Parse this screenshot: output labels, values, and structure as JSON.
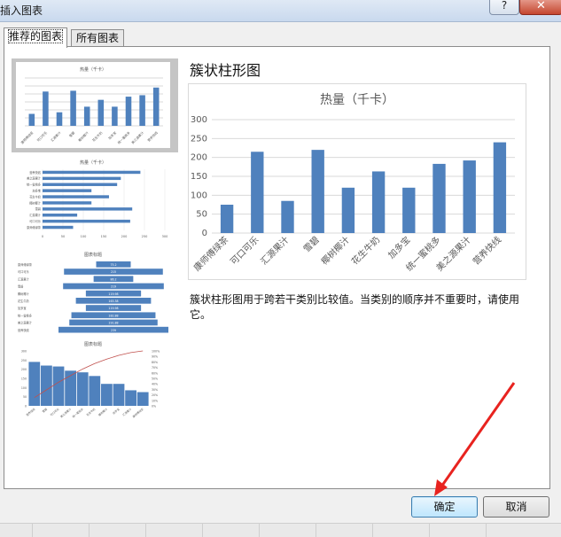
{
  "window": {
    "title": "插入图表",
    "help": "?",
    "close": "✕"
  },
  "tabs": {
    "recommended": "推荐的图表",
    "all": "所有图表"
  },
  "detail": {
    "chart_name": "簇状柱形图",
    "description": "簇状柱形图用于跨若干类别比较值。当类别的顺序并不重要时，请使用它。"
  },
  "buttons": {
    "ok": "确定",
    "cancel": "取消"
  },
  "colors": {
    "accent": "#4f81bd",
    "pareto_line": "#c0504d",
    "selected": "#c5c5c5"
  },
  "chart_data": [
    {
      "type": "bar",
      "title": "热量（千卡）",
      "categories": [
        "康师傅绿茶",
        "可口可乐",
        "汇源果汁",
        "雪碧",
        "椰树椰汁",
        "花生牛奶",
        "加多宝",
        "统一蜜桃多",
        "美之源果汁",
        "营养快线"
      ],
      "values": [
        75,
        215,
        85,
        220,
        120,
        163,
        120,
        183,
        192,
        240
      ],
      "ylim": [
        0,
        300
      ],
      "yticks": [
        0,
        50,
        100,
        150,
        200,
        250,
        300
      ],
      "grid": true
    },
    {
      "type": "bar",
      "orientation": "horizontal",
      "title": "热量（千卡）",
      "categories": [
        "营养快线",
        "美之源果汁",
        "统一蜜桃多",
        "加多宝",
        "花生牛奶",
        "椰树椰汁",
        "雪碧",
        "汇源果汁",
        "可口可乐",
        "康师傅绿茶"
      ],
      "values": [
        240,
        192,
        183,
        120,
        163,
        120,
        220,
        85,
        215,
        75
      ],
      "xlim": [
        0,
        300
      ],
      "xticks": [
        0,
        50,
        100,
        150,
        200,
        250,
        300
      ]
    },
    {
      "type": "bar",
      "orientation": "horizontal",
      "title": "图表标题",
      "categories": [
        "康师傅绿茶",
        "可口可乐",
        "汇源果汁",
        "雪碧",
        "椰树椰汁",
        "花生牛奶",
        "加多宝",
        "统一蜜桃多",
        "美之源果汁",
        "营养快线"
      ],
      "values": [
        75.2,
        215,
        86.2,
        219,
        119.98,
        163.38,
        119.98,
        182.88,
        191.88,
        239
      ]
    },
    {
      "type": "bar",
      "title": "图表标题",
      "categories": [
        "营养快线",
        "雪碧",
        "可口可乐",
        "美之源果汁",
        "统一蜜桃多",
        "花生牛奶",
        "椰树椰汁",
        "加多宝",
        "汇源果汁",
        "康师傅绿茶"
      ],
      "values": [
        240,
        220,
        215,
        192,
        183,
        163,
        120,
        120,
        85,
        75
      ],
      "ylim": [
        0,
        300
      ],
      "yticks": [
        0,
        50,
        100,
        150,
        200,
        250,
        300
      ],
      "y2ticks": [
        "0%",
        "10%",
        "20%",
        "30%",
        "40%",
        "50%",
        "60%",
        "70%",
        "80%",
        "90%",
        "100%"
      ],
      "cumulative_percent": [
        15,
        29,
        43,
        55,
        67,
        77,
        85,
        92,
        97,
        100
      ]
    }
  ]
}
